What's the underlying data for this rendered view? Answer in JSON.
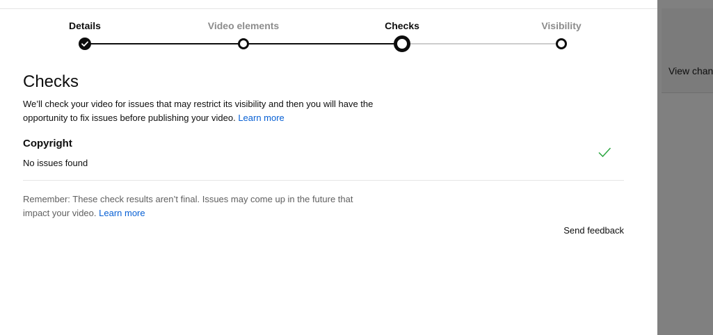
{
  "stepper": {
    "steps": [
      {
        "label": "Details",
        "state": "done"
      },
      {
        "label": "Video elements",
        "state": "inactive"
      },
      {
        "label": "Checks",
        "state": "current"
      },
      {
        "label": "Visibility",
        "state": "inactive"
      }
    ]
  },
  "page": {
    "title": "Checks",
    "intro": "We’ll check your video for issues that may restrict its visibility and then you will have the opportunity to fix issues before publishing your video.",
    "intro_link": "Learn more"
  },
  "checks": {
    "copyright_title": "Copyright",
    "copyright_status": "No issues found",
    "status_icon": "checkmark-icon",
    "status_color": "#2ba640"
  },
  "footer": {
    "remember": "Remember: These check results aren’t final. Issues may come up in the future that impact your video.",
    "remember_link": "Learn more",
    "feedback": "Send feedback"
  },
  "backdrop": {
    "text": "View chan"
  },
  "colors": {
    "link": "#065fd4",
    "text": "#0d0d0d",
    "muted": "#606060",
    "inactive_step": "#8c8c8c"
  }
}
